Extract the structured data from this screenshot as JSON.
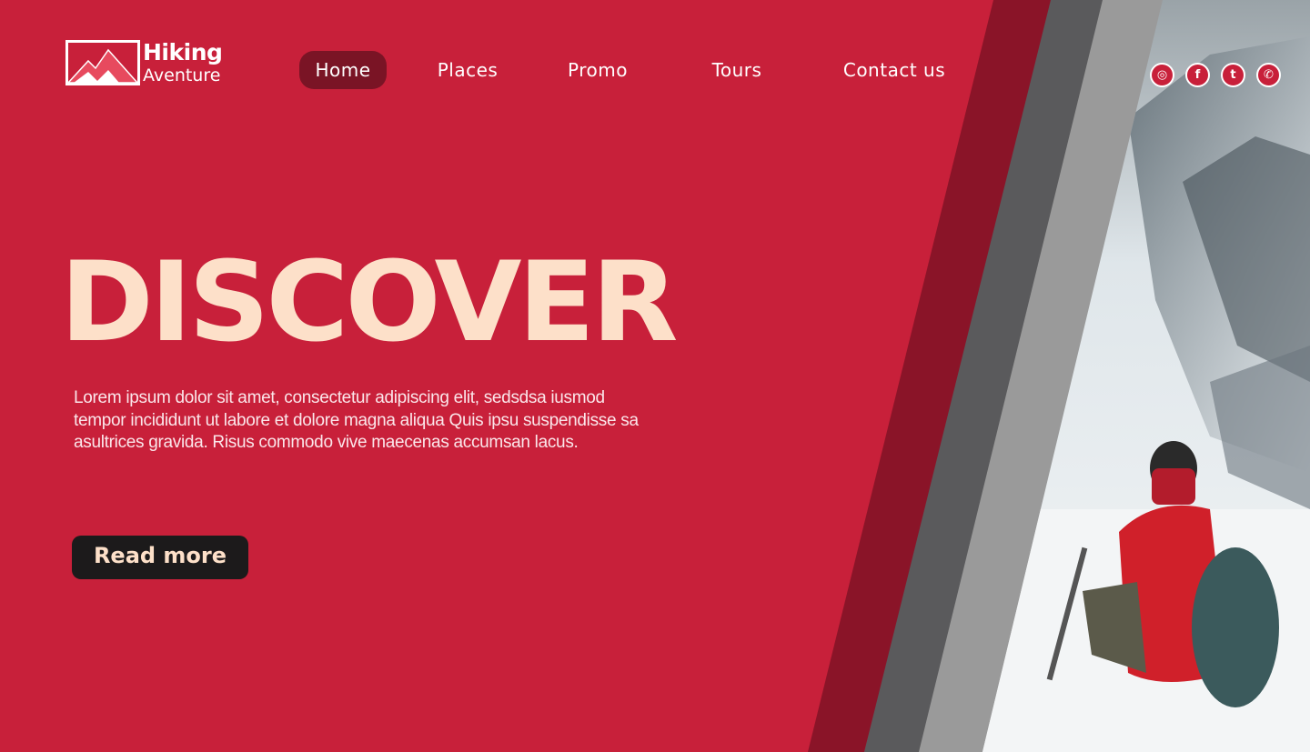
{
  "brand": {
    "title": "Hiking",
    "subtitle": "Aventure"
  },
  "nav": {
    "items": [
      {
        "label": "Home",
        "active": true
      },
      {
        "label": "Places",
        "active": false
      },
      {
        "label": "Promo",
        "active": false
      },
      {
        "label": "Tours",
        "active": false
      },
      {
        "label": "Contact us",
        "active": false
      }
    ]
  },
  "social": [
    {
      "icon": "instagram-icon",
      "glyph": "◎"
    },
    {
      "icon": "facebook-icon",
      "glyph": "f"
    },
    {
      "icon": "twitter-icon",
      "glyph": "t"
    },
    {
      "icon": "whatsapp-icon",
      "glyph": "✆"
    }
  ],
  "hero": {
    "headline": "DISCOVER",
    "body": "Lorem ipsum dolor sit amet, consectetur adipiscing elit, sedsdsa  iusmod tempor incididunt ut labore et dolore magna aliqua Quis ipsu suspendisse sa asultrices gravida. Risus commodo vive maecenas accumsan lacus.",
    "cta": "Read more"
  },
  "colors": {
    "primary": "#c8203a",
    "primary_dark": "#7a1425",
    "accent_text": "#fde0c9",
    "button_bg": "#1c1a1b"
  }
}
